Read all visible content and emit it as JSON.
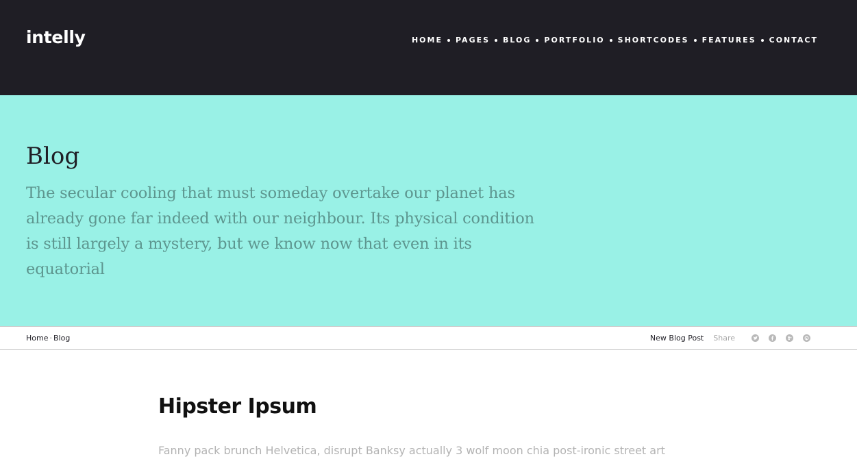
{
  "header": {
    "logo": "intelly",
    "nav": [
      {
        "label": "HOME"
      },
      {
        "label": "PAGES"
      },
      {
        "label": "BLOG"
      },
      {
        "label": "PORTFOLIO"
      },
      {
        "label": "SHORTCODES"
      },
      {
        "label": "FEATURES"
      },
      {
        "label": "CONTACT"
      }
    ]
  },
  "hero": {
    "title": "Blog",
    "text": "The secular cooling that must someday overtake our planet has already gone far indeed with our neighbour. Its physical condition is still largely a mystery, but we know now that even in its equatorial"
  },
  "breadcrumb": {
    "home": "Home",
    "separator": "·",
    "current": "Blog",
    "new_post": "New Blog Post",
    "share": "Share",
    "social_icons": [
      "twitter-icon",
      "facebook-icon",
      "google-plus-icon",
      "pinterest-icon"
    ]
  },
  "post": {
    "title": "Hipster Ipsum",
    "excerpt": "Fanny pack brunch Helvetica, disrupt Banksy actually 3 wolf moon chia post-ironic street art"
  },
  "colors": {
    "header_bg": "#1f1e25",
    "hero_bg": "#99f1e6",
    "hero_text": "#5d968f"
  }
}
